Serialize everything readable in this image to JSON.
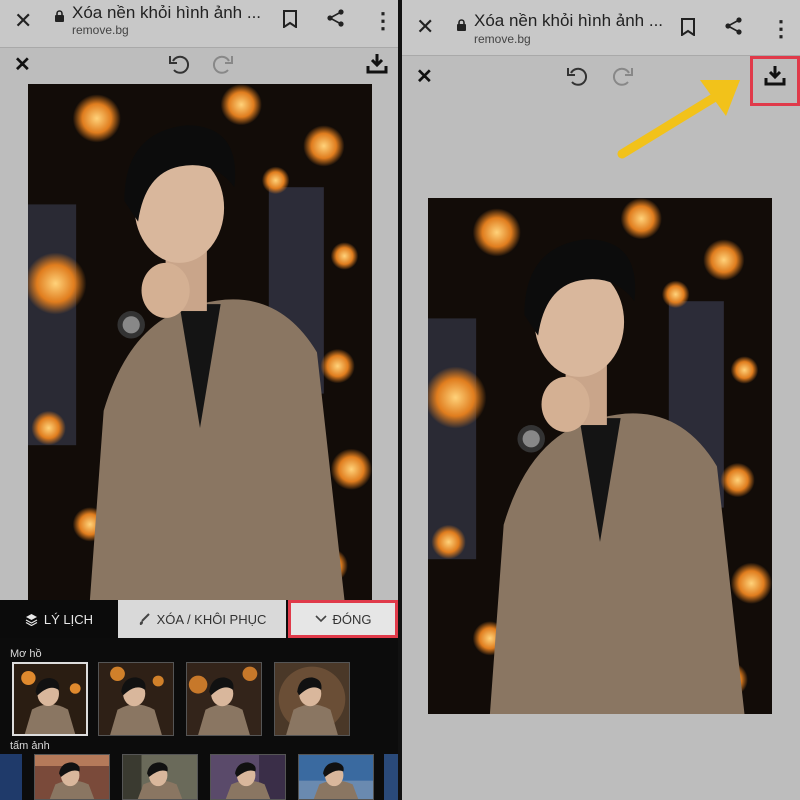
{
  "browser": {
    "title": "Xóa nền khỏi hình ảnh ...",
    "url": "remove.bg",
    "close_icon": "close-icon",
    "lock_icon": "lock-icon",
    "bookmark_icon": "bookmark-icon",
    "share_icon": "share-icon",
    "menu_icon": "more-vert-icon"
  },
  "toolbar": {
    "close_icon": "close-icon",
    "undo_icon": "undo-icon",
    "redo_icon": "redo-icon",
    "download_icon": "download-icon"
  },
  "editor": {
    "tabs": [
      {
        "label": "LÝ LỊCH",
        "icon": "layers-icon"
      },
      {
        "label": "XÓA / KHÔI PHỤC",
        "icon": "brush-icon"
      },
      {
        "label": "ĐÓNG",
        "icon": "chevron-down-icon"
      }
    ],
    "sections": [
      {
        "label": "Mơ hồ"
      },
      {
        "label": "tấm ảnh"
      }
    ]
  },
  "colors": {
    "highlight": "#e03a4a",
    "arrow": "#f2c21a"
  }
}
